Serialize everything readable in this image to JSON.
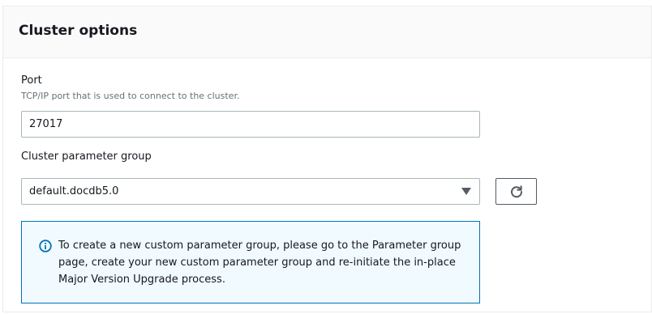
{
  "section": {
    "title": "Cluster options"
  },
  "port": {
    "label": "Port",
    "description": "TCP/IP port that is used to connect to the cluster.",
    "value": "27017"
  },
  "parameter_group": {
    "label": "Cluster parameter group",
    "selected": "default.docdb5.0",
    "refresh_icon": "refresh-icon"
  },
  "info": {
    "icon": "info-icon",
    "text": "To create a new custom parameter group, please go to the Parameter group page, create your new custom parameter group and re-initiate the in-place Major Version Upgrade process."
  },
  "colors": {
    "info_border": "#0073bb",
    "info_background": "#f1faff",
    "header_background": "#fafafa"
  }
}
